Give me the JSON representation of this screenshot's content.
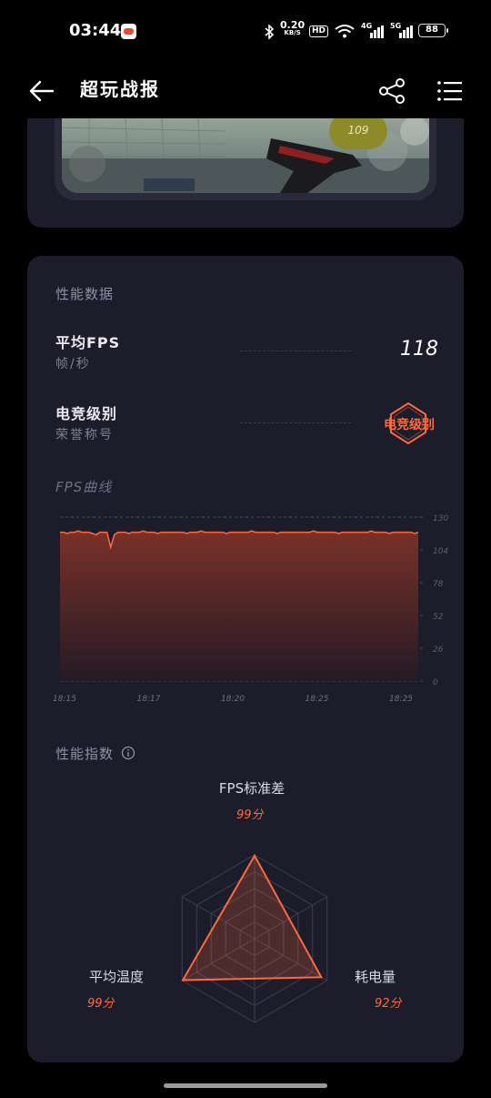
{
  "status_bar": {
    "time": "03:44",
    "net_speed_value": "0.20",
    "net_speed_unit": "KB/S",
    "hd_label": "HD",
    "sig1_label": "4G",
    "sig2_label": "5G",
    "battery": "88",
    "icons": [
      "game-app-icon",
      "bluetooth-icon",
      "wifi-icon",
      "signal-icon",
      "battery-icon"
    ]
  },
  "header": {
    "title": "超玩战报",
    "icons": [
      "back-arrow-icon",
      "share-icon",
      "menu-list-icon"
    ]
  },
  "screenshot": {
    "fps_bubble": "109"
  },
  "performance": {
    "section_title": "性能数据",
    "avg_fps": {
      "label": "平均FPS",
      "unit": "帧/秒",
      "value": "118"
    },
    "esports_level": {
      "label": "电竞级别",
      "sub": "荣誉称号",
      "badge": "电竞级别"
    },
    "accent_color": "#ff6a3d"
  },
  "fps_chart": {
    "section_title": "FPS曲线"
  },
  "chart_data": {
    "type": "area",
    "title": "FPS曲线",
    "y_ticks": [
      "130",
      "104",
      "78",
      "52",
      "26",
      "0"
    ],
    "ylim": [
      0,
      130
    ],
    "x_ticks": [
      "18:15",
      "18:17",
      "18:20",
      "18:25",
      "18:25"
    ],
    "grid": true,
    "series": [
      {
        "values": [
          118,
          118,
          117,
          118,
          118,
          119,
          118,
          118,
          118,
          117,
          116,
          118,
          118,
          118,
          106,
          116,
          118,
          118,
          118,
          117,
          118,
          118,
          118,
          119,
          118,
          118,
          118,
          117,
          118,
          118,
          118,
          118,
          118,
          118,
          118,
          117,
          118,
          118,
          118,
          119,
          118,
          118,
          118,
          118,
          118,
          118,
          117,
          118,
          118,
          118,
          118,
          118,
          118,
          119,
          118,
          118,
          118,
          118,
          118,
          118,
          117,
          118,
          118,
          118,
          118,
          118,
          118,
          118,
          118,
          118,
          119,
          118,
          118,
          118,
          118,
          118,
          118,
          117,
          118,
          118,
          118,
          118,
          118,
          118,
          118,
          118,
          119,
          118,
          118,
          118,
          118,
          117,
          118,
          118,
          118,
          118,
          118,
          118,
          117,
          118
        ]
      }
    ],
    "colors": {
      "line": "#ff6a3d",
      "fill_top": "#7a3128",
      "fill_bottom": "#241a26"
    }
  },
  "radar": {
    "section_title": "性能指数",
    "info_icon": "info-icon",
    "axes": [
      {
        "label": "FPS标准差",
        "score": "99分",
        "value": 99
      },
      {
        "label": "耗电量",
        "score": "92分",
        "value": 92
      },
      {
        "label": "平均温度",
        "score": "99分",
        "value": 99
      }
    ],
    "max": 100
  }
}
